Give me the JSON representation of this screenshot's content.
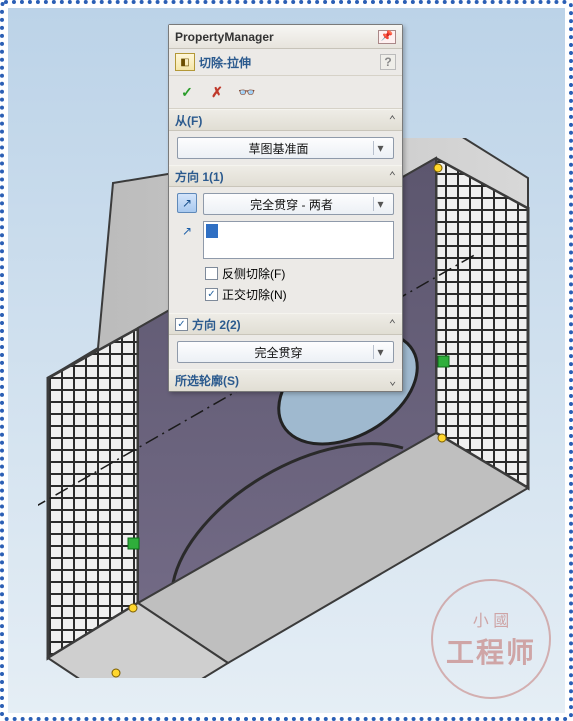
{
  "pm": {
    "title": "PropertyManager",
    "feature": "切除-拉伸",
    "help": "?",
    "actions": {
      "ok": "✓",
      "cancel": "✗",
      "preview": "👓"
    },
    "from": {
      "header": "从(F)",
      "value": "草图基准面"
    },
    "dir1": {
      "header": "方向 1(1)",
      "endcond": "完全贯穿 - 两者",
      "flip_icon": "↗",
      "sel_icon": "↗",
      "options": {
        "reverse": {
          "label": "反侧切除(F)",
          "checked": false
        },
        "normal": {
          "label": "正交切除(N)",
          "checked": true
        }
      }
    },
    "dir2": {
      "header": "方向 2(2)",
      "checked": true,
      "endcond": "完全贯穿"
    },
    "contours": {
      "header": "所选轮廓(S)"
    }
  },
  "watermark": {
    "line1": "小 國",
    "line2": "工程师"
  }
}
